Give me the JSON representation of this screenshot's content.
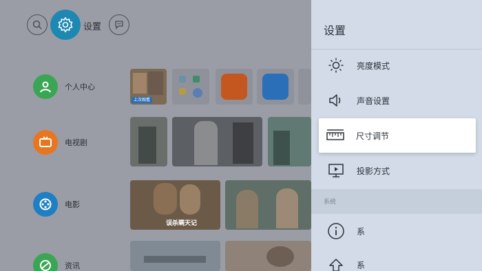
{
  "topbar": {
    "search_icon": "search-icon",
    "settings_label": "设置",
    "message_icon": "message-icon"
  },
  "sidenav": [
    {
      "label": "个人中心",
      "icon": "user-icon",
      "color": "#3aa655"
    },
    {
      "label": "电视剧",
      "icon": "tv-icon",
      "color": "#e8751f"
    },
    {
      "label": "电影",
      "icon": "film-reel-icon",
      "color": "#1e7fc4"
    },
    {
      "label": "资讯",
      "icon": "news-icon",
      "color": "#3aa655"
    }
  ],
  "tiles": {
    "recent_caption": "上次观看",
    "poster_caption": "误杀瞒天记"
  },
  "panel": {
    "title": "设置",
    "items": [
      {
        "label": "亮度模式",
        "icon": "brightness-icon"
      },
      {
        "label": "声音设置",
        "icon": "speaker-icon"
      },
      {
        "label": "尺寸调节",
        "icon": "ruler-icon"
      },
      {
        "label": "投影方式",
        "icon": "projector-icon"
      }
    ],
    "section_label": "系统",
    "system_items": [
      {
        "label": "系",
        "icon": "info-icon"
      },
      {
        "label": "系",
        "icon": "upgrade-icon"
      }
    ]
  },
  "colors": {
    "panel_bg": "#d2dbe7",
    "active_item_bg": "#ffffff",
    "settings_accent": "#1e87b2"
  }
}
